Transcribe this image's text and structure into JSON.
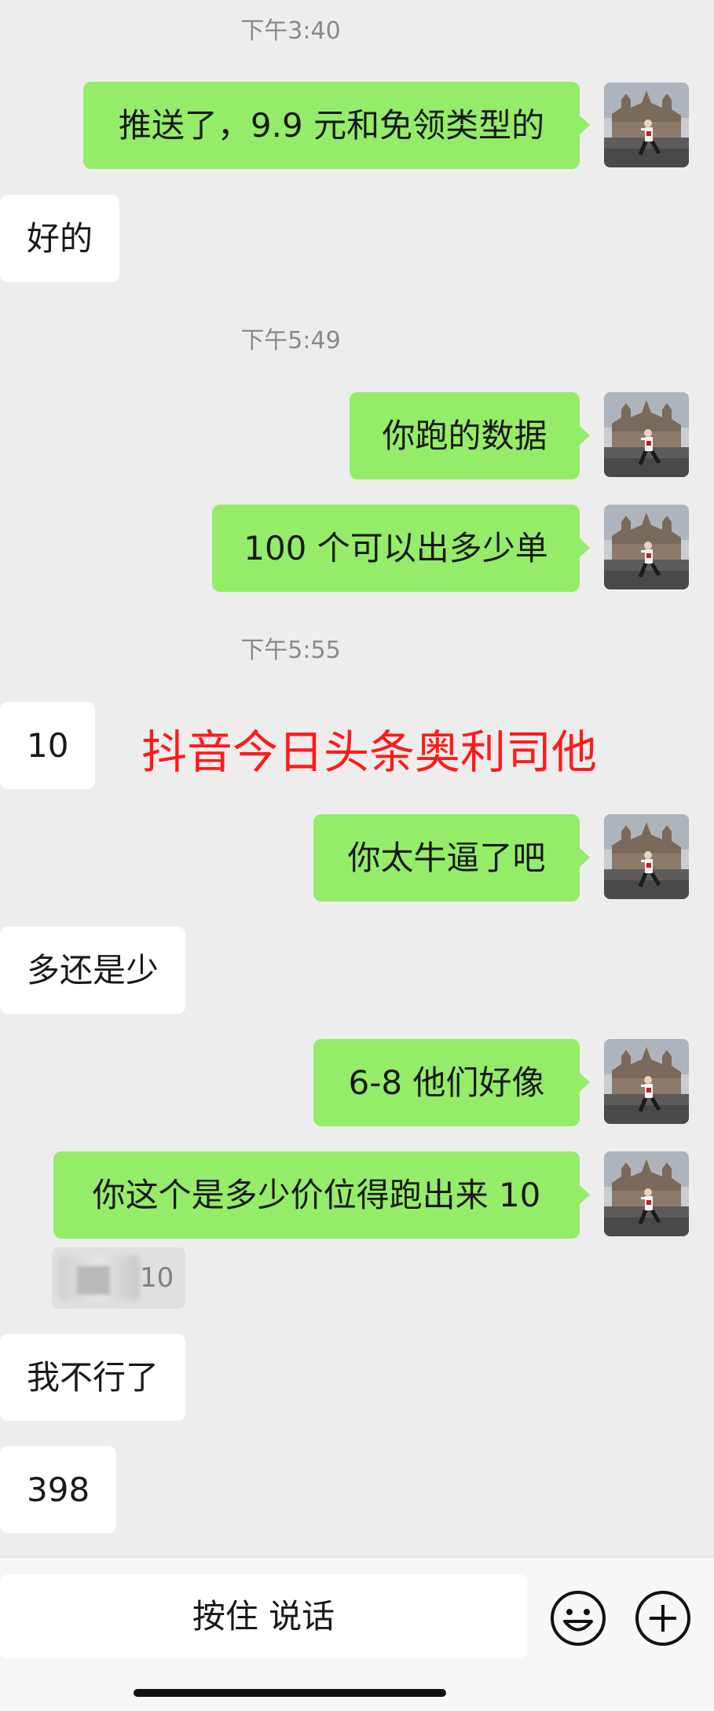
{
  "timestamps": [
    "下午3:40",
    "下午5:49",
    "下午5:55"
  ],
  "messages": [
    {
      "side": "sent",
      "text": "推送了，9.9 元和免领类型的"
    },
    {
      "side": "received",
      "text": "好的"
    },
    {
      "side": "sent",
      "text": "你跑的数据"
    },
    {
      "side": "sent",
      "text": "100 个可以出多少单"
    },
    {
      "side": "received",
      "text": "10"
    },
    {
      "side": "sent",
      "text": "你太牛逼了吧"
    },
    {
      "side": "received",
      "text": "多还是少"
    },
    {
      "side": "sent",
      "text": "6-8 他们好像"
    },
    {
      "side": "sent",
      "text": "你这个是多少价位得跑出来 10"
    },
    {
      "side": "received",
      "text": "我不行了"
    },
    {
      "side": "received",
      "text": "398"
    }
  ],
  "quote": {
    "text": "10"
  },
  "overlay_text": "抖音今日头条奥利司他",
  "input_bar": {
    "voice_label": "按住 说话"
  },
  "icons": {
    "emoji": "emoji-icon",
    "plus": "plus-icon"
  },
  "colors": {
    "sent_bubble": "#95ec69",
    "received_bubble": "#ffffff",
    "background": "#ededed",
    "overlay": "#ff1a1a"
  }
}
